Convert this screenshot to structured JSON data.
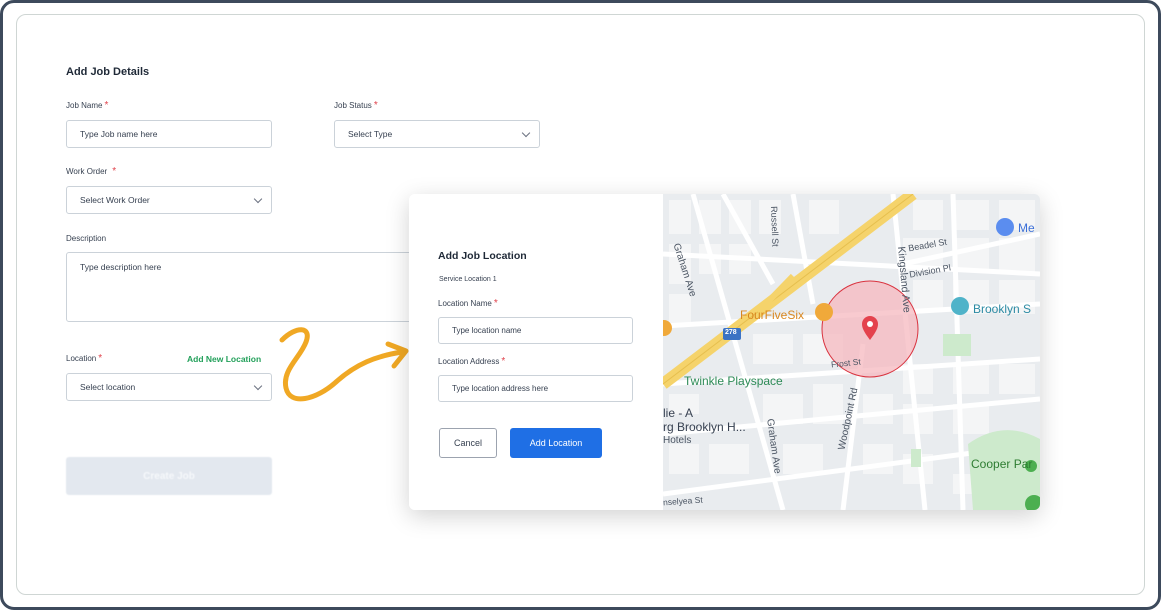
{
  "form": {
    "title": "Add Job Details",
    "job_name": {
      "label": "Job Name",
      "required_mark": "*",
      "placeholder": "Type Job name here"
    },
    "job_status": {
      "label": "Job Status",
      "required_mark": "*",
      "value": "Select Type"
    },
    "work_order": {
      "label": "Work Order",
      "required_mark": "*",
      "value": "Select Work Order"
    },
    "description": {
      "label": "Description",
      "placeholder": "Type description here"
    },
    "location": {
      "label": "Location",
      "required_mark": "*",
      "value": "Select location",
      "add_link": "Add New Location"
    },
    "create_button": "Create Job"
  },
  "modal": {
    "title": "Add Job Location",
    "section_label": "Service Location 1",
    "location_name": {
      "label": "Location Name",
      "required_mark": "*",
      "placeholder": "Type location name"
    },
    "location_address": {
      "label": "Location Address",
      "required_mark": "*",
      "placeholder": "Type location address here"
    },
    "cancel_button": "Cancel",
    "add_button": "Add Location"
  },
  "map": {
    "streets": {
      "graham_ave_top": "Graham Ave",
      "graham_ave_bottom": "Graham Ave",
      "russell_st": "Russell St",
      "kingsland_ave": "Kingsland Ave",
      "beadel_st": "Beadel St",
      "division_pl": "Division Pl",
      "frost_st": "Frost St",
      "woodpoint_rd": "Woodpoint Rd",
      "anselyea_st": "nselyea St",
      "highway_shield": "278"
    },
    "places": {
      "fourfivesix": "FourFiveSix",
      "twinkle": "Twinkle Playspace",
      "brooklyn": "Brooklyn S",
      "hotel_line1": "lie - A",
      "hotel_line2": "rg Brooklyn H...",
      "hotel_line3": "Hotels",
      "cooper": "Cooper Par",
      "me": "Me"
    },
    "colors": {
      "highway": "#f5d36b",
      "radius_fill": "#f6b8bf",
      "radius_stroke": "#d9323e",
      "pin": "#e4424d",
      "park": "#cdeacc"
    }
  },
  "decor": {
    "arrow_color": "#f0a824"
  }
}
